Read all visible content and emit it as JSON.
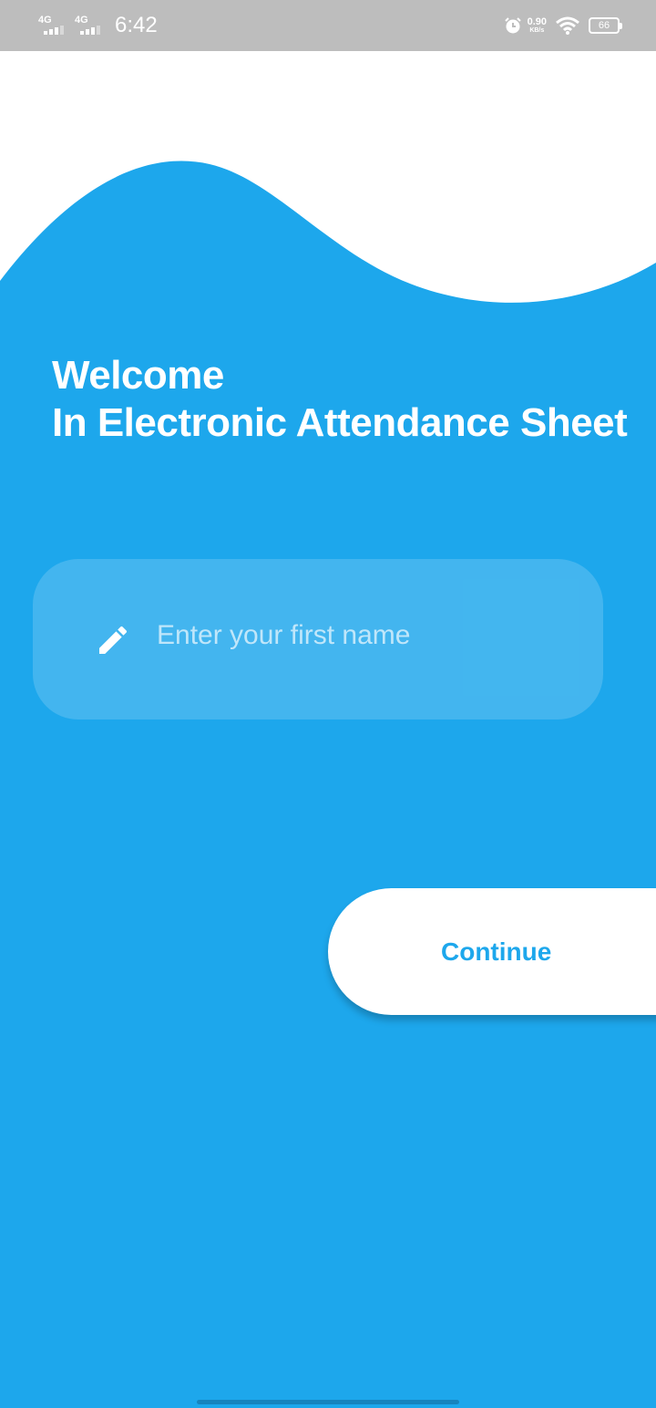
{
  "status_bar": {
    "network_1": "4G",
    "network_2": "4G",
    "time": "6:42",
    "speed_value": "0.90",
    "speed_unit": "KB/s",
    "battery": "66",
    "icons": [
      "signal-icon",
      "alarm-icon",
      "wifi-icon",
      "battery-icon"
    ]
  },
  "welcome": {
    "line1": "Welcome",
    "line2": "In Electronic Attendance Sheet"
  },
  "name_field": {
    "placeholder": "Enter your first name",
    "value": "",
    "icon": "pencil-icon"
  },
  "continue_button": {
    "label": "Continue"
  },
  "colors": {
    "primary": "#1DA7EC",
    "status_bar": "#BDBDBD",
    "button_bg": "#FFFFFF",
    "placeholder": "#BFE6FA"
  }
}
